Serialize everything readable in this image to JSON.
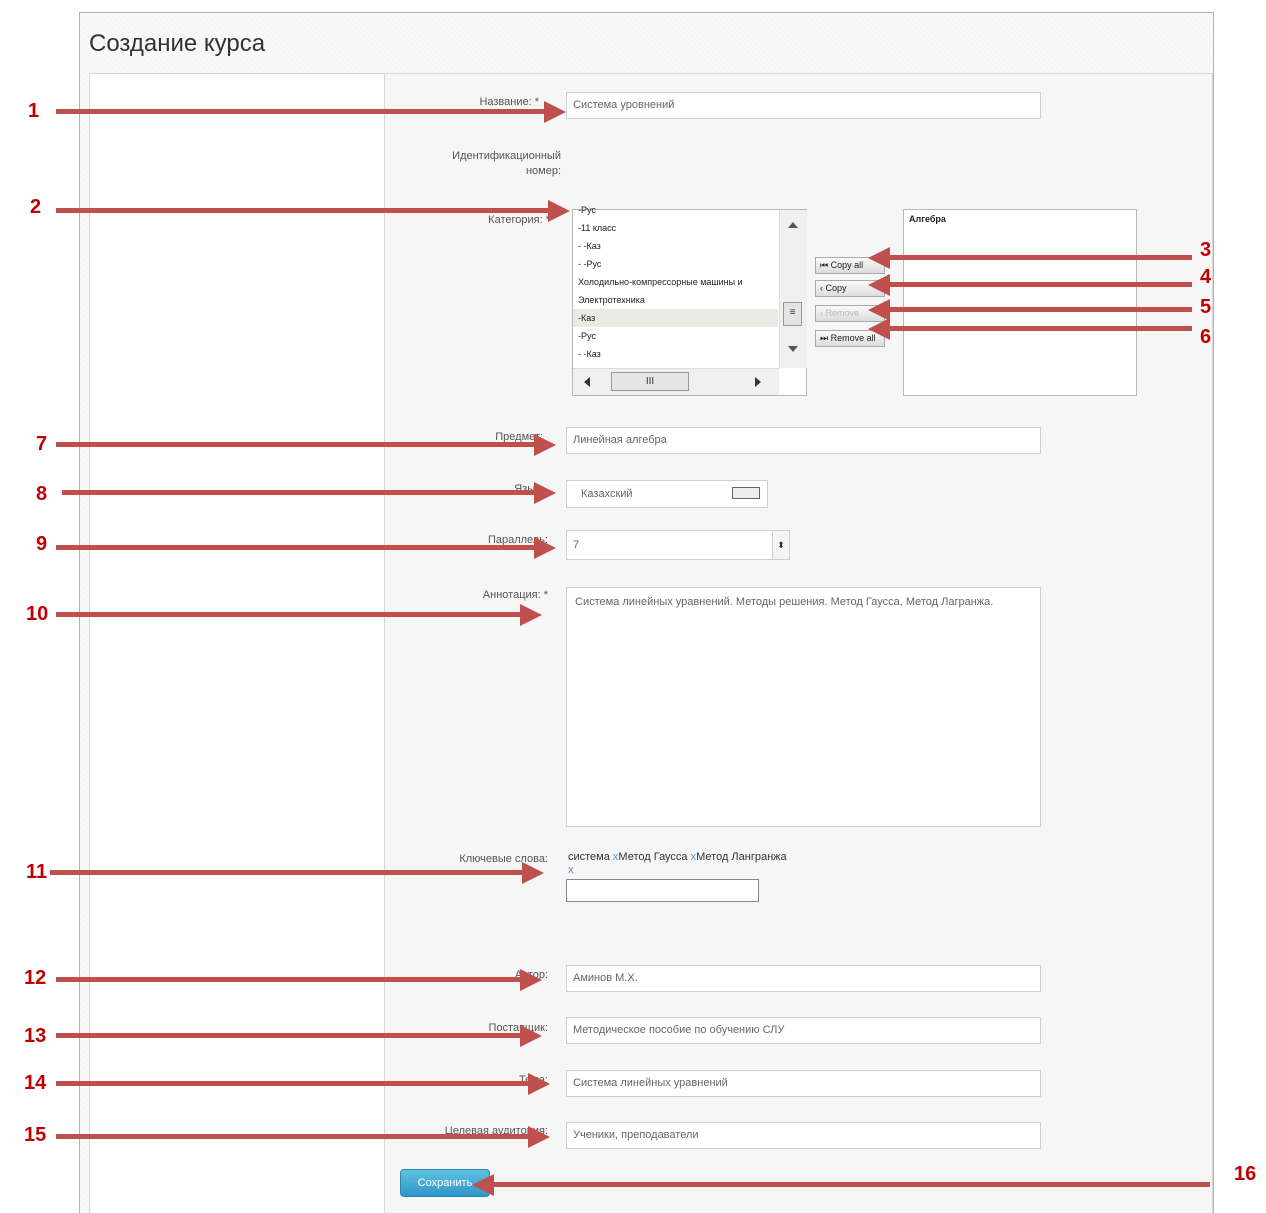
{
  "page_title": "Создание курса",
  "fields": {
    "name": {
      "label": "Название: *",
      "value": "Система уровнений"
    },
    "id_number": {
      "label_line1": "Идентификационный",
      "label_line2": "номер:"
    },
    "category": {
      "label": "Категория: *"
    },
    "subject": {
      "label": "Предмет:",
      "value": "Линейная алгебра"
    },
    "language": {
      "label": "Язык:",
      "value": "Казахский"
    },
    "parallel": {
      "label": "Параллель:",
      "value": "7"
    },
    "annotation": {
      "label": "Аннотация: *",
      "value": "Система линейных уравнений. Методы решения. Метод Гаусса, Метод Лагранжа."
    },
    "keywords": {
      "label": "Ключевые слова:",
      "tags": [
        "система",
        "Метод Гаусса",
        "Метод Лангранжа"
      ],
      "remove_glyph": "x"
    },
    "author": {
      "label": "Автор:",
      "value": "Аминов М.Х."
    },
    "supplier": {
      "label": "Поставщик:",
      "value": "Методическое пособие по обучению СЛУ"
    },
    "topic": {
      "label": "Тема:",
      "value": "Система линейных уравнений"
    },
    "audience": {
      "label": "Целевая аудитория:",
      "value": "Ученики, преподаватели"
    }
  },
  "category_list": {
    "items": [
      "-Рус",
      "-11 класс",
      "- -Каз",
      "- -Рус",
      "Холодильно-компрессорные машины и",
      "Электротехника",
      "-Каз",
      "-Рус",
      "- -Каз"
    ],
    "selected_index": 6,
    "selected_items": [
      "Алгебра"
    ]
  },
  "move_buttons": {
    "copy_all": "Copy all",
    "copy": "Copy",
    "remove": "Remove",
    "remove_all": "Remove all"
  },
  "save_button": "Сохранить",
  "annotations": [
    "1",
    "2",
    "3",
    "4",
    "5",
    "6",
    "7",
    "8",
    "9",
    "10",
    "11",
    "12",
    "13",
    "14",
    "15",
    "16"
  ],
  "colors": {
    "arrow": "#c0504d",
    "number": "#c00000",
    "save_button": "#3aa3d3"
  }
}
